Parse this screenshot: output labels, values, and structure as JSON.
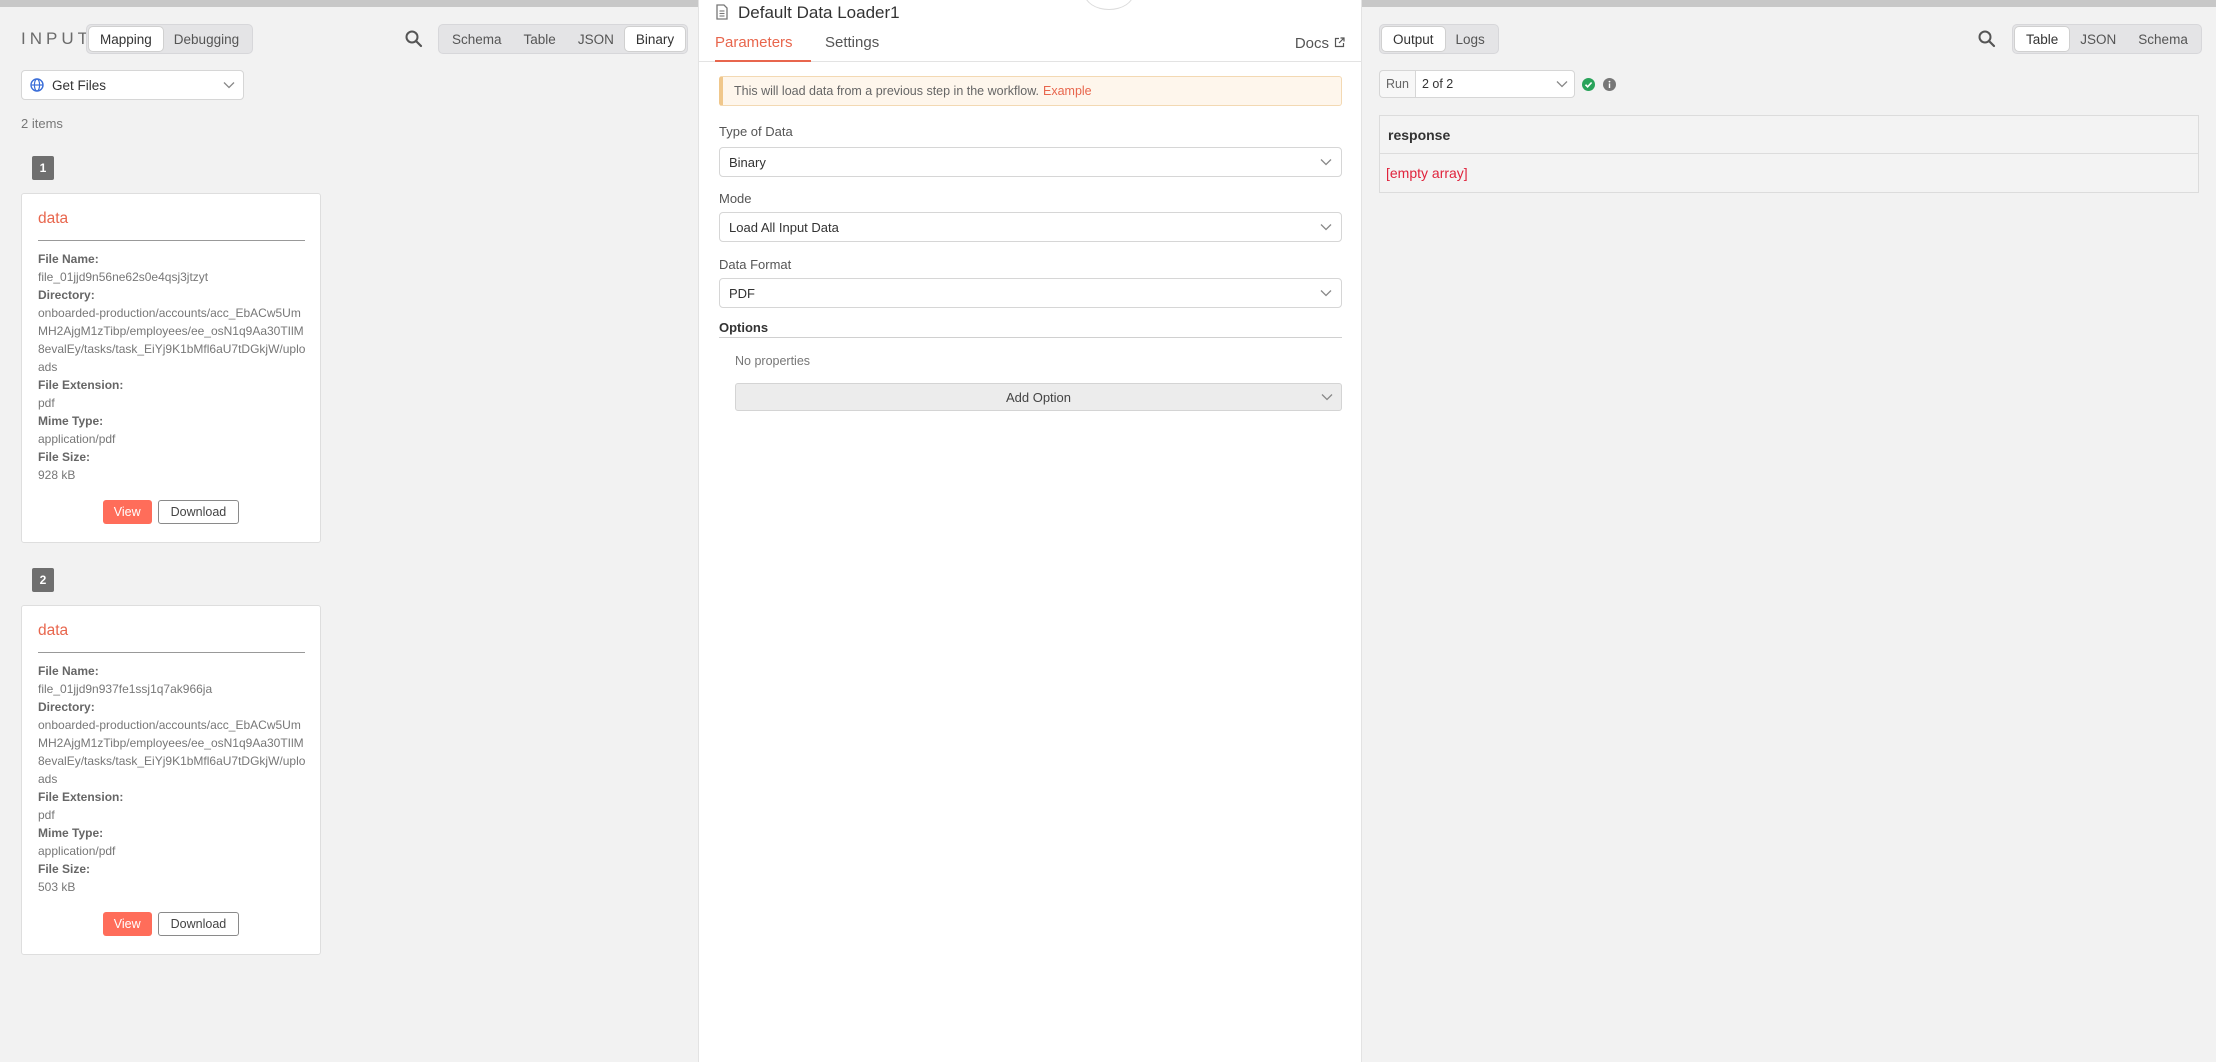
{
  "input_panel": {
    "label": "INPUT",
    "mapping_tabs": [
      "Mapping",
      "Debugging"
    ],
    "view_tabs": [
      "Schema",
      "Table",
      "JSON",
      "Binary"
    ],
    "node_select": "Get Files",
    "items_count": "2 items",
    "items": [
      {
        "index": "1",
        "title": "data",
        "file_name_label": "File Name:",
        "file_name": "file_01jjd9n56ne62s0e4qsj3jtzyt",
        "directory_label": "Directory:",
        "directory": "onboarded-production/accounts/acc_EbACw5UmMH2AjgM1zTibp/employees/ee_osN1q9Aa30TIlM8evalEy/tasks/task_EiYj9K1bMfl6aU7tDGkjW/uploads",
        "extension_label": "File Extension:",
        "extension": "pdf",
        "mime_label": "Mime Type:",
        "mime": "application/pdf",
        "size_label": "File Size:",
        "size": "928 kB",
        "view_label": "View",
        "download_label": "Download"
      },
      {
        "index": "2",
        "title": "data",
        "file_name_label": "File Name:",
        "file_name": "file_01jjd9n937fe1ssj1q7ak966ja",
        "directory_label": "Directory:",
        "directory": "onboarded-production/accounts/acc_EbACw5UmMH2AjgM1zTibp/employees/ee_osN1q9Aa30TIlM8evalEy/tasks/task_EiYj9K1bMfl6aU7tDGkjW/uploads",
        "extension_label": "File Extension:",
        "extension": "pdf",
        "mime_label": "Mime Type:",
        "mime": "application/pdf",
        "size_label": "File Size:",
        "size": "503 kB",
        "view_label": "View",
        "download_label": "Download"
      }
    ]
  },
  "node": {
    "title": "Default Data Loader1",
    "tabs": [
      "Parameters",
      "Settings"
    ],
    "docs_label": "Docs",
    "notice_text": "This will load data from a previous step in the workflow.",
    "notice_link": "Example",
    "type_of_data_label": "Type of Data",
    "type_of_data_value": "Binary",
    "mode_label": "Mode",
    "mode_value": "Load All Input Data",
    "data_format_label": "Data Format",
    "data_format_value": "PDF",
    "options_label": "Options",
    "no_properties": "No properties",
    "add_option_label": "Add Option"
  },
  "output_panel": {
    "tabs": [
      "Output",
      "Logs"
    ],
    "view_tabs": [
      "Table",
      "JSON",
      "Schema"
    ],
    "run_label": "Run",
    "run_value": "2 of 2",
    "table_header": "response",
    "table_value": "[empty array]"
  },
  "colors": {
    "accent": "#ff6d5a",
    "accent_text": "#e8664d",
    "success": "#29a35a",
    "error_text": "#e0233c"
  }
}
